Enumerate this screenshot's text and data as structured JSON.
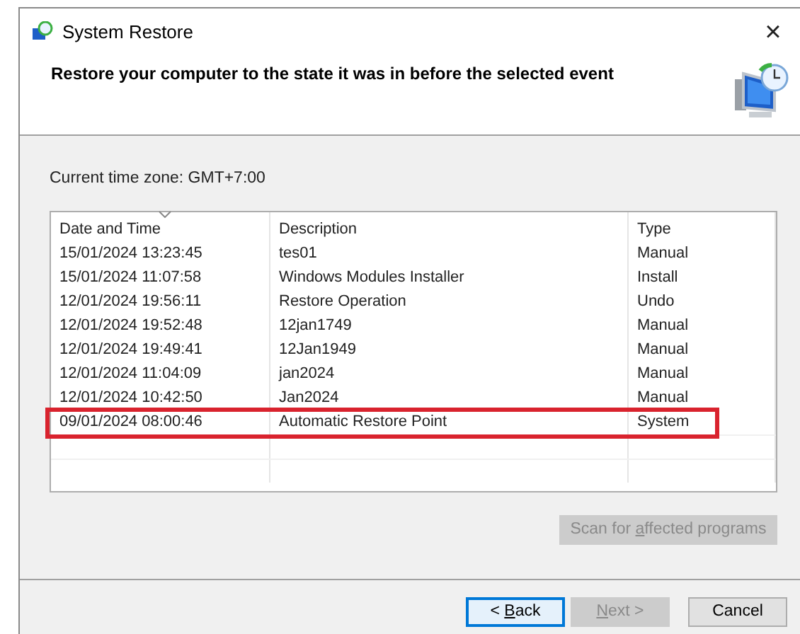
{
  "window": {
    "title": "System Restore",
    "close": "×"
  },
  "header": {
    "heading": "Restore your computer to the state it was in before the selected event"
  },
  "timezone": "Current time zone: GMT+7:00",
  "table": {
    "columns": [
      {
        "label": "Date and Time",
        "sorted": true
      },
      {
        "label": "Description",
        "sorted": false
      },
      {
        "label": "Type",
        "sorted": false
      }
    ],
    "rows": [
      {
        "cells": [
          "15/01/2024 13:23:45",
          "tes01",
          "Manual"
        ],
        "highlighted": false
      },
      {
        "cells": [
          "15/01/2024 11:07:58",
          "Windows Modules Installer",
          "Install"
        ],
        "highlighted": false
      },
      {
        "cells": [
          "12/01/2024 19:56:11",
          "Restore Operation",
          "Undo"
        ],
        "highlighted": false
      },
      {
        "cells": [
          "12/01/2024 19:52:48",
          "12jan1749",
          "Manual"
        ],
        "highlighted": false
      },
      {
        "cells": [
          "12/01/2024 19:49:41",
          "12Jan1949",
          "Manual"
        ],
        "highlighted": false
      },
      {
        "cells": [
          "12/01/2024 11:04:09",
          "jan2024",
          "Manual"
        ],
        "highlighted": false
      },
      {
        "cells": [
          "12/01/2024 10:42:50",
          "Jan2024",
          "Manual"
        ],
        "highlighted": false
      },
      {
        "cells": [
          "09/01/2024 08:00:46",
          "Automatic Restore Point",
          "System"
        ],
        "highlighted": true
      }
    ]
  },
  "scan_button": {
    "before": "Scan for ",
    "key": "a",
    "after": "ffected programs",
    "disabled": true
  },
  "buttons": [
    {
      "before": "< ",
      "key": "B",
      "after": "ack",
      "disabled": false,
      "focused": true
    },
    {
      "key": "N",
      "after": "ext >",
      "disabled": true,
      "focused": false
    },
    {
      "before": "Cancel",
      "disabled": false,
      "focused": false
    }
  ]
}
